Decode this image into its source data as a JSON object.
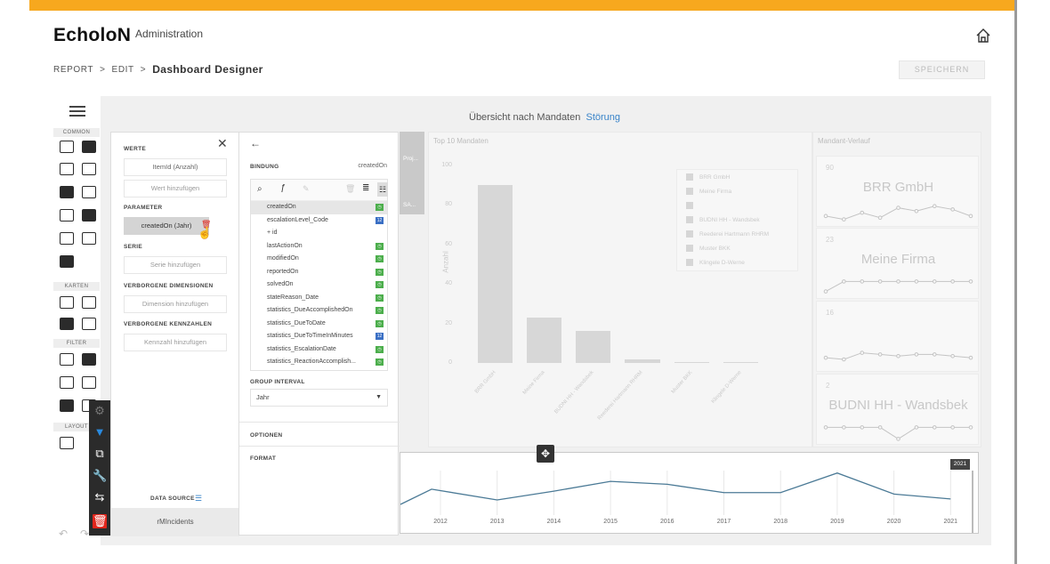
{
  "header": {
    "logo": "EcholoN",
    "subtitle": "Administration",
    "home_icon": "home-icon"
  },
  "breadcrumb": {
    "items": [
      "REPORT",
      "EDIT"
    ],
    "current": "Dashboard Designer",
    "separator": ">"
  },
  "save_button": "SPEICHERN",
  "toolbox": {
    "sections": [
      "COMMON",
      "KARTEN",
      "FILTER",
      "LAYOUT"
    ],
    "icons": [
      "grid-icon",
      "sigma-icon",
      "bar-chart-icon",
      "treemap-icon",
      "pie-icon",
      "scatter-icon",
      "card-icon",
      "gauge-icon",
      "text-box-icon",
      "image-icon",
      "image-alt-icon",
      "dot-map-icon",
      "choropleth-map-icon",
      "bubble-map-icon",
      "pie-map-icon",
      "combo-box-icon",
      "list-box-icon",
      "tree-view-icon",
      "tab-icon",
      "date-filter-icon",
      "group-icon",
      "tab-container-icon"
    ]
  },
  "colors": {
    "accent": "#f7a81e",
    "link": "#3a84c9",
    "green_badge": "#4cae4c",
    "blue_badge": "#3a6fc4",
    "delete": "#e1251b"
  },
  "dashboard": {
    "title": "Übersicht nach Mandaten",
    "title_link": "Störung",
    "bar_card_title": "Top 10 Mandaten",
    "trend_card_title": "Mandant-Verlauf",
    "left_card_title": "Proj...",
    "left_card_sub": "SA...",
    "y_axis_label": "Anzahl"
  },
  "chart_data": [
    {
      "type": "bar",
      "title": "Top 10 Mandaten",
      "ylabel": "Anzahl",
      "categories": [
        "BRR GmbH",
        "Meine Firma",
        "BUDNI HH - Wandsbek",
        "Reederei Hartmann RHRM",
        "Muster BKK",
        "Klingele D-Werne"
      ],
      "values": [
        90,
        23,
        16,
        2,
        0.5,
        0.5
      ],
      "yticks": [
        "0",
        "20",
        "40",
        "60",
        "80",
        "100"
      ],
      "ylim": [
        0,
        100
      ],
      "legend": [
        "BRR GmbH",
        "Meine Firma",
        "",
        "BUDNI HH - Wandsbek",
        "Reederei Hartmann RHRM",
        "Muster BKK",
        "Klingele D-Werne"
      ]
    },
    {
      "type": "line",
      "title": "",
      "x": [
        "2012",
        "2013",
        "2014",
        "2015",
        "2016",
        "2017",
        "2018",
        "2019",
        "2020",
        "2021"
      ],
      "values": [
        62,
        40,
        58,
        78,
        72,
        55,
        55,
        95,
        52,
        42
      ],
      "selected_label": "2021"
    }
  ],
  "trend_cards": [
    {
      "number": "90",
      "name": "BRR GmbH",
      "spark": [
        30,
        20,
        40,
        25,
        55,
        45,
        60,
        50,
        30
      ]
    },
    {
      "number": "23",
      "name": "Meine Firma",
      "spark": [
        20,
        50,
        50,
        50,
        50,
        50,
        50,
        50,
        50
      ]
    },
    {
      "number": "16",
      "name": "",
      "spark": [
        40,
        35,
        55,
        50,
        45,
        50,
        50,
        45,
        40
      ]
    },
    {
      "number": "2",
      "name": "BUDNI HH - Wandsbek",
      "spark": [
        50,
        50,
        50,
        50,
        15,
        50,
        50,
        50,
        50
      ]
    }
  ],
  "panel_left": {
    "werte": "WERTE",
    "werte_item": "ItemId (Anzahl)",
    "werte_add": "Wert hinzufügen",
    "parameter": "PARAMETER",
    "parameter_item": "createdOn (Jahr)",
    "serie": "SERIE",
    "serie_add": "Serie hinzufügen",
    "verborgene_dimensionen": "VERBORGENE DIMENSIONEN",
    "dimension_add": "Dimension hinzufügen",
    "verborgene_kennzahlen": "VERBORGENE KENNZAHLEN",
    "kennzahl_add": "Kennzahl hinzufügen",
    "data_source_label": "DATA SOURCE",
    "data_source_name": "rMIncidents"
  },
  "panel_right": {
    "bindung": "BINDUNG",
    "bindung_value": "createdOn",
    "fields": [
      {
        "name": "createdOn",
        "type": "date",
        "selected": true
      },
      {
        "name": "escalationLevel_Code",
        "type": "num"
      },
      {
        "name": "+ id",
        "type": "none"
      },
      {
        "name": "lastActionOn",
        "type": "date"
      },
      {
        "name": "modifiedOn",
        "type": "date"
      },
      {
        "name": "reportedOn",
        "type": "date"
      },
      {
        "name": "solvedOn",
        "type": "date"
      },
      {
        "name": "stateReason_Date",
        "type": "date"
      },
      {
        "name": "statistics_DueAccomplishedOn",
        "type": "date"
      },
      {
        "name": "statistics_DueToDate",
        "type": "date"
      },
      {
        "name": "statistics_DueToTimeInMinutes",
        "type": "num"
      },
      {
        "name": "statistics_EscalationDate",
        "type": "date"
      },
      {
        "name": "statistics_ReactionAccomplish...",
        "type": "date"
      }
    ],
    "group_interval": "GROUP INTERVAL",
    "group_interval_value": "Jahr",
    "optionen": "OPTIONEN",
    "format": "FORMAT"
  },
  "badges": {
    "date": "◷",
    "num": "12"
  }
}
